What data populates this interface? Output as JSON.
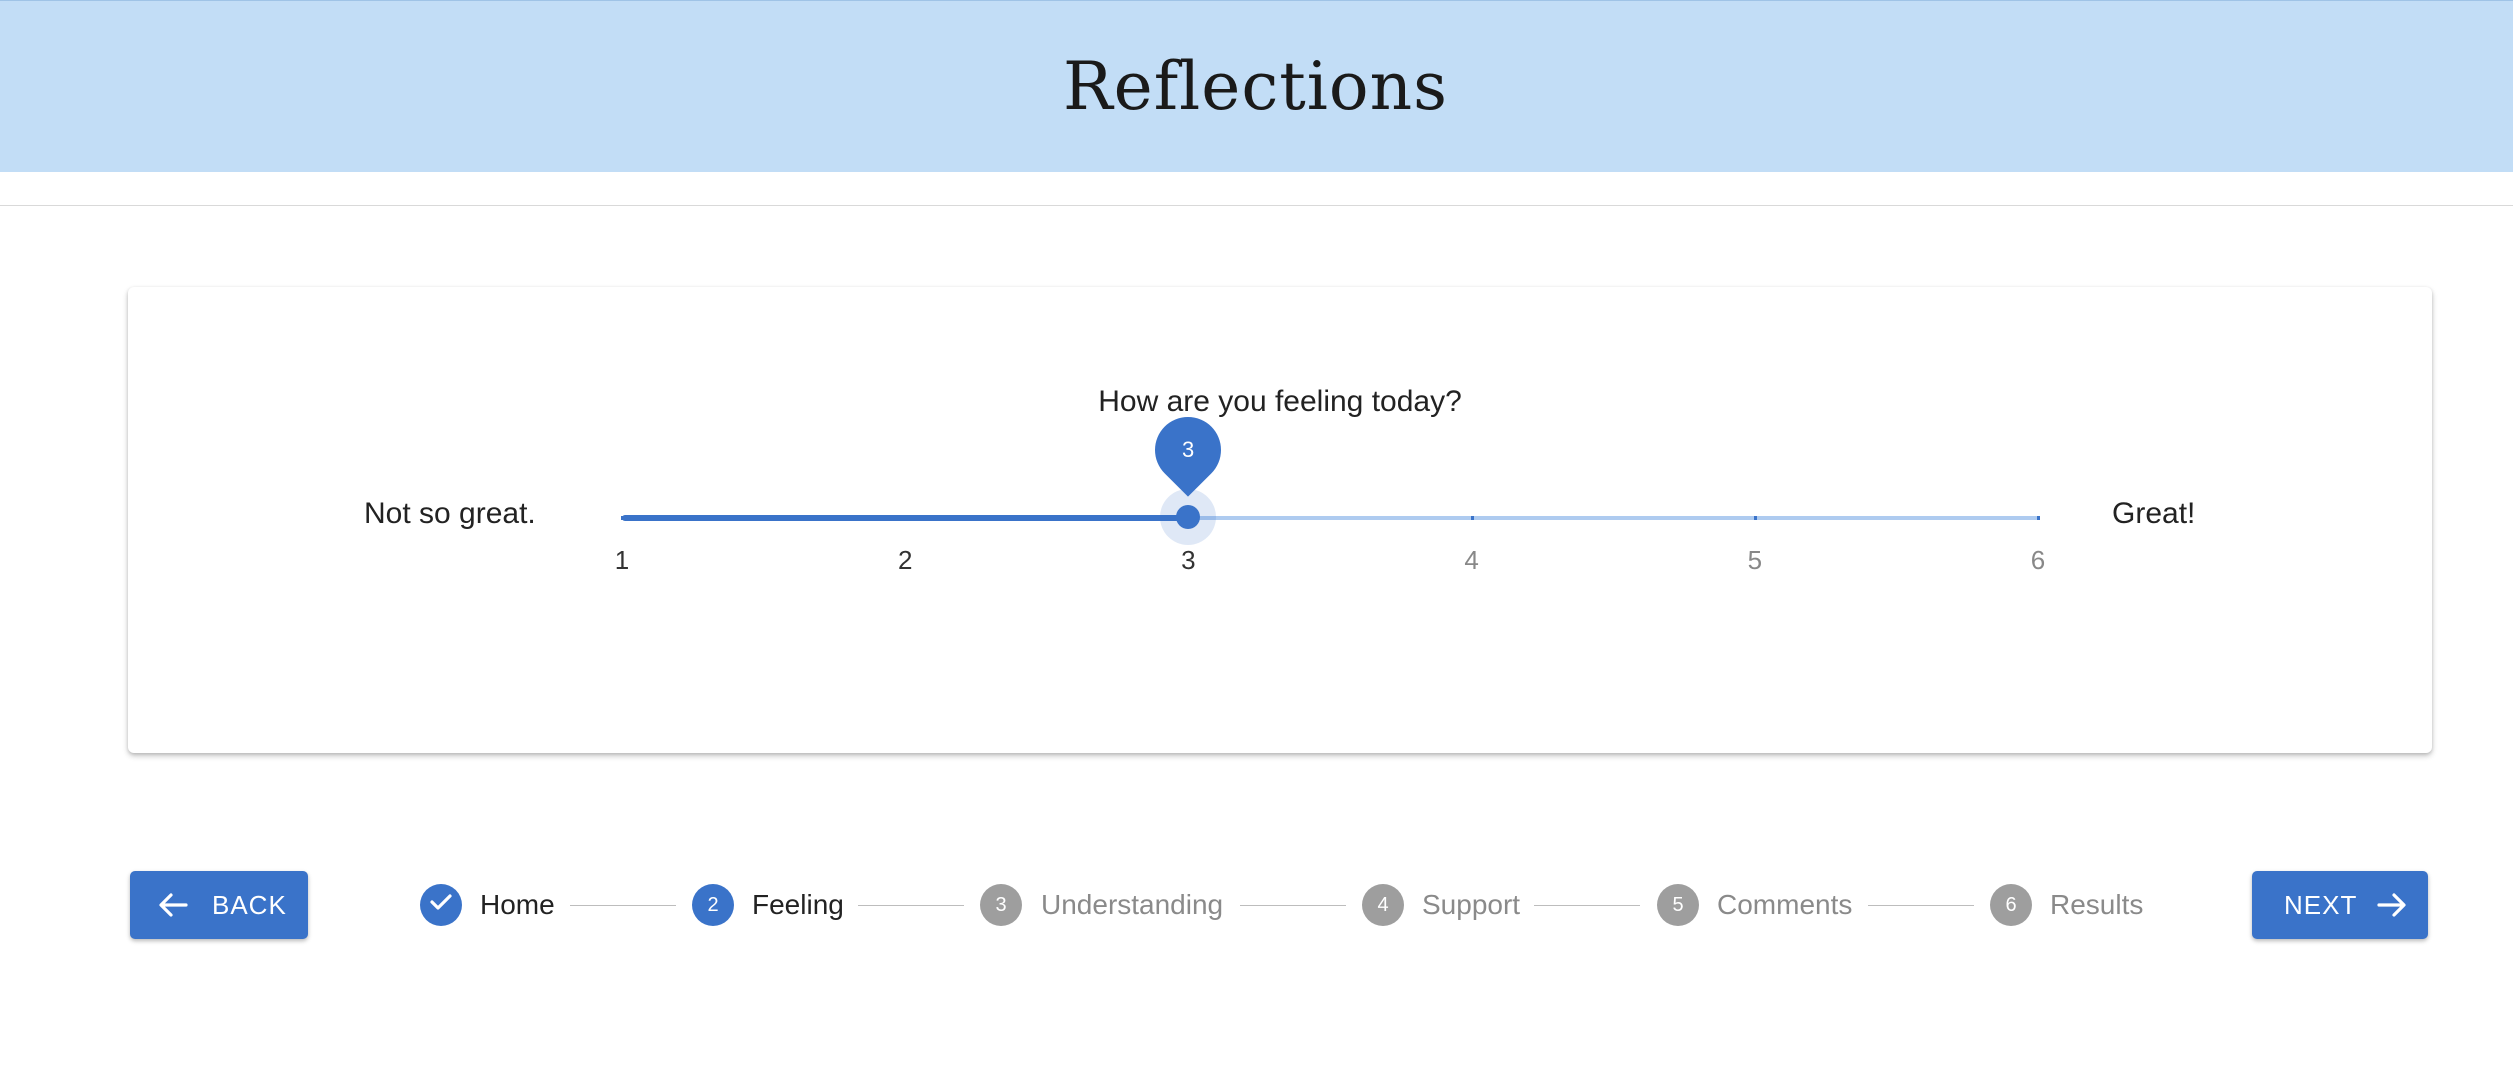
{
  "header": {
    "title": "Reflections"
  },
  "question": {
    "prompt": "How are you feeling today?",
    "min_label": "Not so great.",
    "max_label": "Great!"
  },
  "slider": {
    "min": 1,
    "max": 6,
    "value": 3,
    "value_label": "3",
    "ticks": [
      "1",
      "2",
      "3",
      "4",
      "5",
      "6"
    ],
    "accent_color": "#3a73c9",
    "track_color": "#aecbf0"
  },
  "nav": {
    "back_label": "BACK",
    "next_label": "NEXT"
  },
  "stepper": {
    "steps": [
      {
        "number": "1",
        "label": "Home",
        "state": "done"
      },
      {
        "number": "2",
        "label": "Feeling",
        "state": "active"
      },
      {
        "number": "3",
        "label": "Understanding",
        "state": "pending"
      },
      {
        "number": "4",
        "label": "Support",
        "state": "pending"
      },
      {
        "number": "5",
        "label": "Comments",
        "state": "pending"
      },
      {
        "number": "6",
        "label": "Results",
        "state": "pending"
      }
    ]
  },
  "colors": {
    "header_bg": "#c2ddf6",
    "primary": "#3a73c9",
    "pending": "#9e9e9e"
  }
}
